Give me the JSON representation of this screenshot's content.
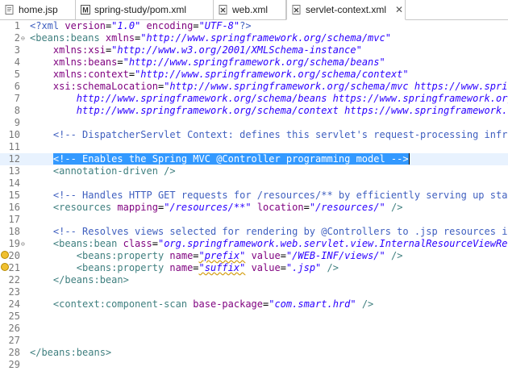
{
  "tabs": [
    {
      "label": "home.jsp",
      "icon": "jsp-file-icon",
      "active": false
    },
    {
      "label": "spring-study/pom.xml",
      "icon": "maven-file-icon",
      "active": false
    },
    {
      "label": "web.xml",
      "icon": "xml-file-icon",
      "active": false
    },
    {
      "label": "servlet-context.xml",
      "icon": "xml-file-icon",
      "active": true,
      "close": "✕"
    }
  ],
  "lines": [
    {
      "num": "1",
      "segs": [
        [
          "pi",
          "<?xml "
        ],
        [
          "attr",
          "version"
        ],
        [
          "txt",
          "="
        ],
        [
          "val",
          "\"1.0\""
        ],
        [
          "txt",
          " "
        ],
        [
          "attr",
          "encoding"
        ],
        [
          "txt",
          "="
        ],
        [
          "val",
          "\"UTF-8\""
        ],
        [
          "pi",
          "?>"
        ]
      ]
    },
    {
      "num": "2",
      "fold": "⊖",
      "segs": [
        [
          "tag",
          "<beans:beans "
        ],
        [
          "attr",
          "xmlns"
        ],
        [
          "txt",
          "="
        ],
        [
          "val",
          "\"http://www.springframework.org/schema/mvc\""
        ]
      ]
    },
    {
      "num": "3",
      "segs": [
        [
          "txt",
          "    "
        ],
        [
          "attr",
          "xmlns:xsi"
        ],
        [
          "txt",
          "="
        ],
        [
          "val",
          "\"http://www.w3.org/2001/XMLSchema-instance\""
        ]
      ]
    },
    {
      "num": "4",
      "segs": [
        [
          "txt",
          "    "
        ],
        [
          "attr",
          "xmlns:beans"
        ],
        [
          "txt",
          "="
        ],
        [
          "val",
          "\"http://www.springframework.org/schema/beans\""
        ]
      ]
    },
    {
      "num": "5",
      "segs": [
        [
          "txt",
          "    "
        ],
        [
          "attr",
          "xmlns:context"
        ],
        [
          "txt",
          "="
        ],
        [
          "val",
          "\"http://www.springframework.org/schema/context\""
        ]
      ]
    },
    {
      "num": "6",
      "segs": [
        [
          "txt",
          "    "
        ],
        [
          "attr",
          "xsi:schemaLocation"
        ],
        [
          "txt",
          "="
        ],
        [
          "val",
          "\"http://www.springframework.org/schema/mvc https://www.sprin"
        ]
      ]
    },
    {
      "num": "7",
      "segs": [
        [
          "val",
          "        http://www.springframework.org/schema/beans https://www.springframework.org"
        ]
      ]
    },
    {
      "num": "8",
      "segs": [
        [
          "val",
          "        http://www.springframework.org/schema/context https://www.springframework.o"
        ]
      ]
    },
    {
      "num": "9",
      "segs": []
    },
    {
      "num": "10",
      "segs": [
        [
          "txt",
          "    "
        ],
        [
          "cm",
          "<!-- DispatcherServlet Context: defines this servlet's request-processing infra"
        ]
      ]
    },
    {
      "num": "11",
      "segs": []
    },
    {
      "num": "12",
      "highlight": true,
      "segs": [
        [
          "txt",
          "    "
        ],
        [
          "sel",
          "<!-- Enables the Spring MVC @Controller programming model -->"
        ]
      ]
    },
    {
      "num": "13",
      "segs": [
        [
          "txt",
          "    "
        ],
        [
          "tag",
          "<annotation-driven />"
        ]
      ]
    },
    {
      "num": "14",
      "segs": []
    },
    {
      "num": "15",
      "segs": [
        [
          "txt",
          "    "
        ],
        [
          "cm",
          "<!-- Handles HTTP GET requests for /resources/** by efficiently serving up stat"
        ]
      ]
    },
    {
      "num": "16",
      "segs": [
        [
          "txt",
          "    "
        ],
        [
          "tag",
          "<resources "
        ],
        [
          "attr",
          "mapping"
        ],
        [
          "txt",
          "="
        ],
        [
          "val",
          "\"/resources/**\""
        ],
        [
          "txt",
          " "
        ],
        [
          "attr",
          "location"
        ],
        [
          "txt",
          "="
        ],
        [
          "val",
          "\"/resources/\""
        ],
        [
          "tag",
          " />"
        ]
      ]
    },
    {
      "num": "17",
      "segs": []
    },
    {
      "num": "18",
      "segs": [
        [
          "txt",
          "    "
        ],
        [
          "cm",
          "<!-- Resolves views selected for rendering by @Controllers to .jsp resources in"
        ]
      ]
    },
    {
      "num": "19",
      "fold": "⊖",
      "segs": [
        [
          "txt",
          "    "
        ],
        [
          "tag",
          "<beans:bean "
        ],
        [
          "attr",
          "class"
        ],
        [
          "txt",
          "="
        ],
        [
          "val",
          "\"org.springframework.web.servlet.view.InternalResourceViewRes"
        ]
      ]
    },
    {
      "num": "20",
      "warn": true,
      "segs": [
        [
          "txt",
          "        "
        ],
        [
          "tag",
          "<beans:property "
        ],
        [
          "attr",
          "name"
        ],
        [
          "txt",
          "="
        ],
        [
          "val",
          "\"prefix\""
        ],
        [
          "txt",
          " "
        ],
        [
          "attr",
          "value"
        ],
        [
          "txt",
          "="
        ],
        [
          "val",
          "\"/WEB-INF/views/\""
        ],
        [
          "tag",
          " />"
        ]
      ]
    },
    {
      "num": "21",
      "warn": true,
      "segs": [
        [
          "txt",
          "        "
        ],
        [
          "tag",
          "<beans:property "
        ],
        [
          "attr",
          "name"
        ],
        [
          "txt",
          "="
        ],
        [
          "val",
          "\"suffix\""
        ],
        [
          "txt",
          " "
        ],
        [
          "attr",
          "value"
        ],
        [
          "txt",
          "="
        ],
        [
          "val",
          "\".jsp\""
        ],
        [
          "tag",
          " />"
        ]
      ]
    },
    {
      "num": "22",
      "segs": [
        [
          "txt",
          "    "
        ],
        [
          "tag",
          "</beans:bean>"
        ]
      ]
    },
    {
      "num": "23",
      "segs": []
    },
    {
      "num": "24",
      "segs": [
        [
          "txt",
          "    "
        ],
        [
          "tag",
          "<context:component-scan "
        ],
        [
          "attr",
          "base-package"
        ],
        [
          "txt",
          "="
        ],
        [
          "val",
          "\"com.smart.hrd\""
        ],
        [
          "tag",
          " />"
        ]
      ]
    },
    {
      "num": "25",
      "segs": []
    },
    {
      "num": "26",
      "segs": []
    },
    {
      "num": "27",
      "segs": []
    },
    {
      "num": "28",
      "segs": [
        [
          "tag",
          "</beans:beans>"
        ]
      ]
    },
    {
      "num": "29",
      "segs": []
    }
  ]
}
